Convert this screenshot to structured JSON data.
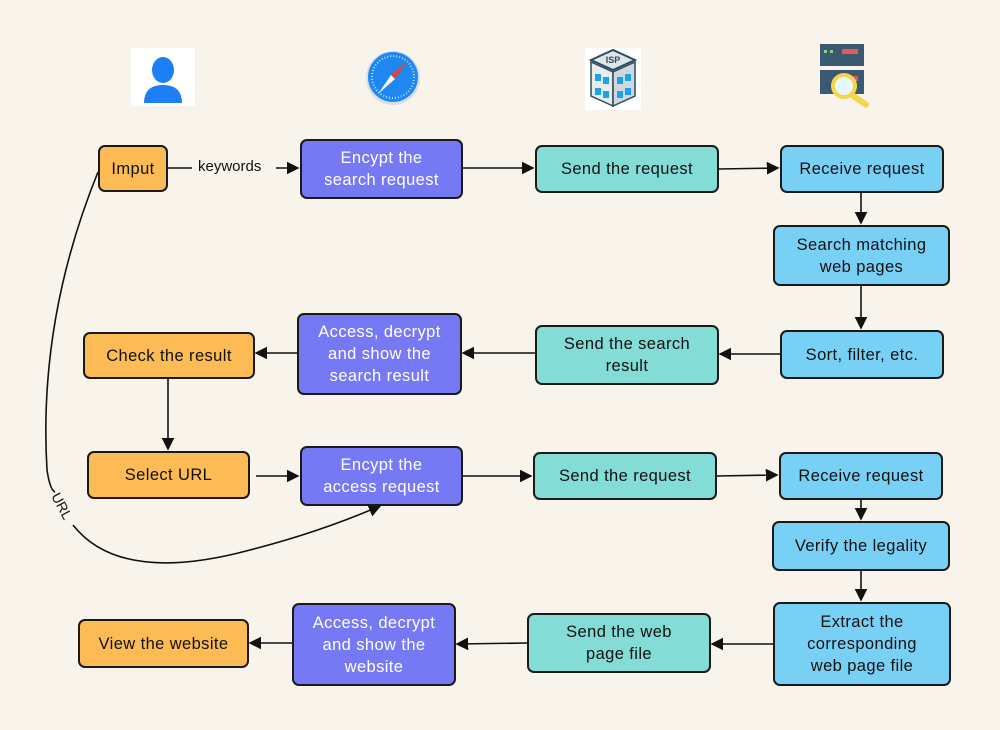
{
  "colors": {
    "background": "#f8f3eb",
    "user": "#fdbb55",
    "browser": "#7679f4",
    "isp": "#83dcd6",
    "server": "#78d0f4"
  },
  "icons": [
    "user-icon",
    "safari-browser-icon",
    "isp-building-icon",
    "server-search-icon"
  ],
  "isp_icon_text": "ISP",
  "edge_labels": {
    "keywords": "keywords",
    "url": "URL"
  },
  "nodes": [
    {
      "label": "Imput",
      "lane": "user"
    },
    {
      "label": "Encypt the\nsearch request",
      "lane": "browser"
    },
    {
      "label": "Send the request",
      "lane": "isp"
    },
    {
      "label": "Receive request",
      "lane": "server"
    },
    {
      "label": "Search matching\nweb pages",
      "lane": "server"
    },
    {
      "label": "Sort, filter, etc.",
      "lane": "server"
    },
    {
      "label": "Send the search\nresult",
      "lane": "isp"
    },
    {
      "label": "Access, decrypt\nand show the\nsearch result",
      "lane": "browser"
    },
    {
      "label": "Check the result",
      "lane": "user"
    },
    {
      "label": "Select URL",
      "lane": "user"
    },
    {
      "label": "Encypt the\naccess request",
      "lane": "browser"
    },
    {
      "label": "Send the request",
      "lane": "isp"
    },
    {
      "label": "Receive request",
      "lane": "server"
    },
    {
      "label": "Verify the legality",
      "lane": "server"
    },
    {
      "label": "Extract the\ncorresponding\nweb page file",
      "lane": "server"
    },
    {
      "label": "Send the web\npage file",
      "lane": "isp"
    },
    {
      "label": "Access, decrypt\nand show the\nwebsite",
      "lane": "browser"
    },
    {
      "label": "View the website",
      "lane": "user"
    }
  ]
}
